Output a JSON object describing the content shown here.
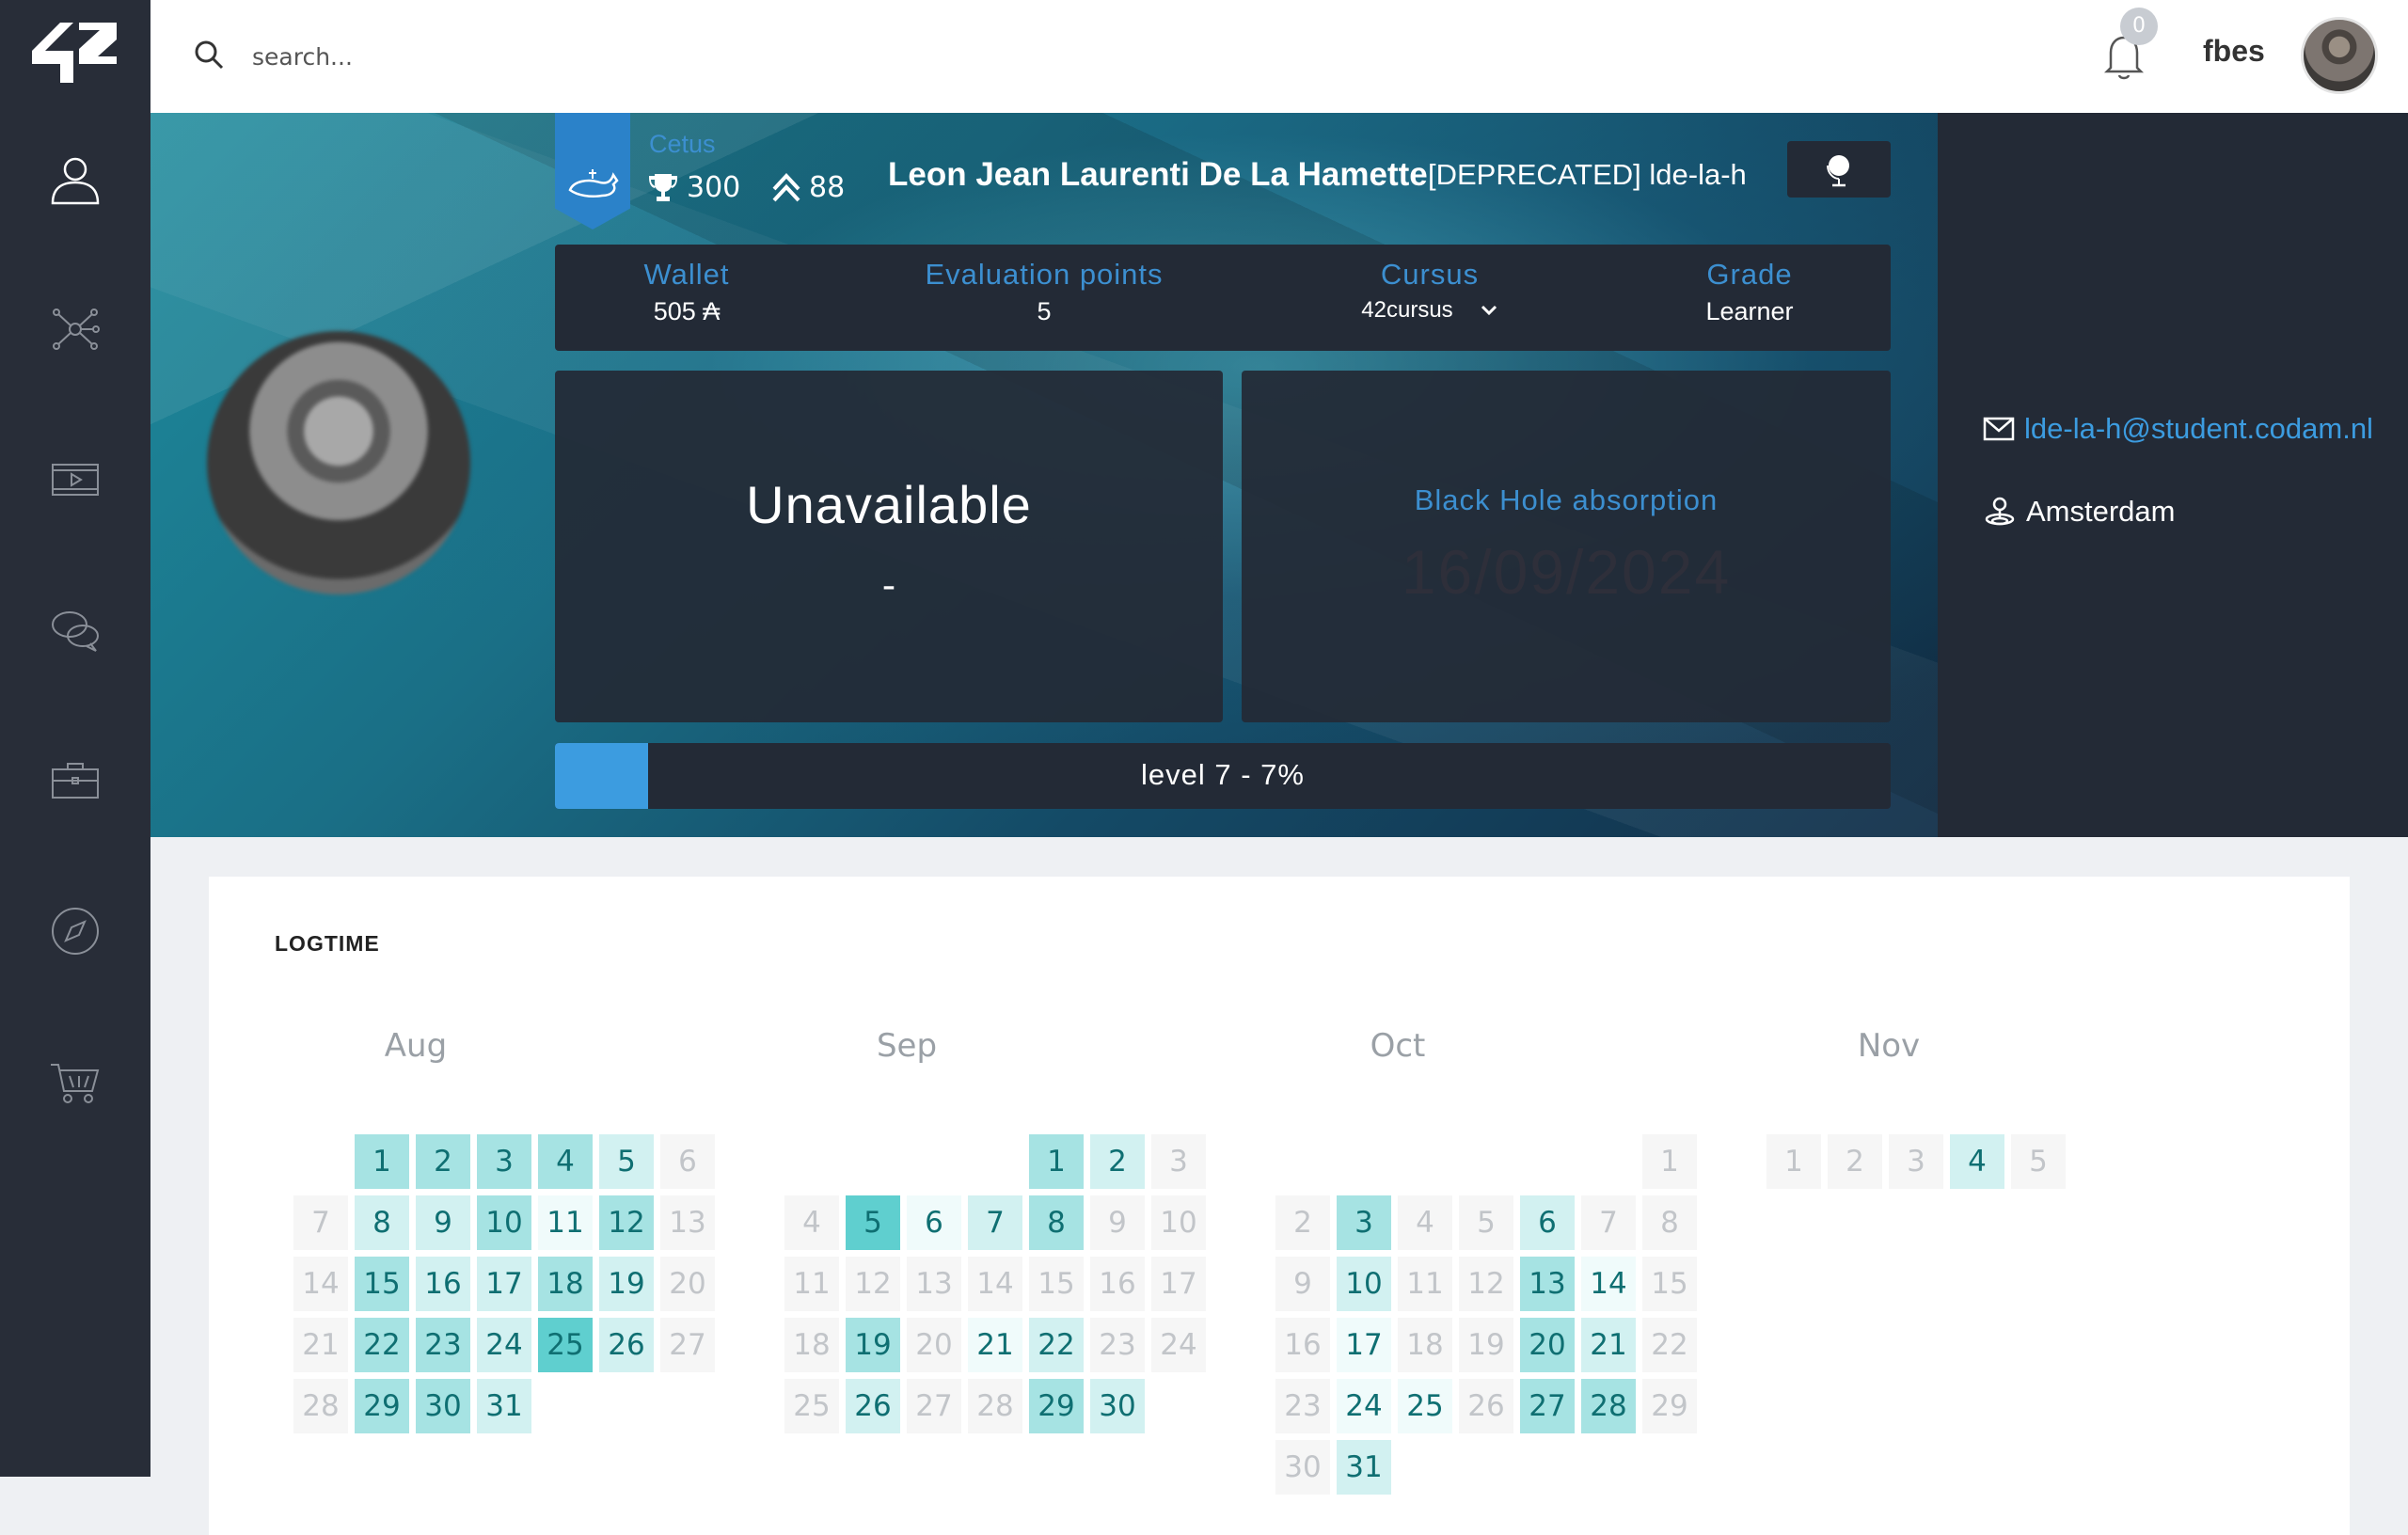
{
  "colors": {
    "sidebar": "#282d38",
    "accent": "#3c8fd0",
    "panel": "#232a36",
    "logtime_dark": "#5fcfcf",
    "logtime_light": "#e6f7f7"
  },
  "sidebar": {
    "icons": [
      "user-icon",
      "network-icon",
      "video-icon",
      "chat-icon",
      "briefcase-icon",
      "compass-icon",
      "cart-icon"
    ]
  },
  "search": {
    "placeholder": "search..."
  },
  "header": {
    "notification_count": "0",
    "username": "fbes"
  },
  "profile": {
    "coalition": "Cetus",
    "trophies": "300",
    "rank": "88",
    "full_name": "Leon Jean Laurenti De La Hamette",
    "login": "[DEPRECATED] lde-la-h",
    "wallet_label": "Wallet",
    "wallet_value": "505 ₳",
    "eval_label": "Evaluation points",
    "eval_value": "5",
    "cursus_label": "Cursus",
    "cursus_value": "42cursus",
    "grade_label": "Grade",
    "grade_value": "Learner",
    "availability": "Unavailable",
    "availability_sub": "-",
    "blackhole_label": "Black Hole absorption",
    "blackhole_date": "16/09/2024",
    "level_text": "level 7 - 7%",
    "level_progress": 0.07,
    "email": "lde-la-h@student.codam.nl",
    "city": "Amsterdam"
  },
  "logtime": {
    "title": "LOGTIME",
    "months": [
      {
        "name": "Aug",
        "rows": [
          [
            null,
            {
              "d": "1",
              "l": 2
            },
            {
              "d": "2",
              "l": 2
            },
            {
              "d": "3",
              "l": 2
            },
            {
              "d": "4",
              "l": 2
            },
            {
              "d": "5",
              "l": 1
            },
            {
              "d": "6",
              "l": 0
            }
          ],
          [
            {
              "d": "7",
              "l": 0
            },
            {
              "d": "8",
              "l": 1
            },
            {
              "d": "9",
              "l": 1
            },
            {
              "d": "10",
              "l": 2
            },
            {
              "d": "11",
              "l": 0.5
            },
            {
              "d": "12",
              "l": 2
            },
            {
              "d": "13",
              "l": 0
            }
          ],
          [
            {
              "d": "14",
              "l": 0
            },
            {
              "d": "15",
              "l": 2
            },
            {
              "d": "16",
              "l": 1
            },
            {
              "d": "17",
              "l": 1
            },
            {
              "d": "18",
              "l": 2
            },
            {
              "d": "19",
              "l": 1
            },
            {
              "d": "20",
              "l": 0
            }
          ],
          [
            {
              "d": "21",
              "l": 0
            },
            {
              "d": "22",
              "l": 2
            },
            {
              "d": "23",
              "l": 2
            },
            {
              "d": "24",
              "l": 1
            },
            {
              "d": "25",
              "l": 3
            },
            {
              "d": "26",
              "l": 1
            },
            {
              "d": "27",
              "l": 0
            }
          ],
          [
            {
              "d": "28",
              "l": 0
            },
            {
              "d": "29",
              "l": 2
            },
            {
              "d": "30",
              "l": 2
            },
            {
              "d": "31",
              "l": 1
            },
            null,
            null,
            null
          ]
        ]
      },
      {
        "name": "Sep",
        "rows": [
          [
            null,
            null,
            null,
            null,
            {
              "d": "1",
              "l": 2
            },
            {
              "d": "2",
              "l": 1
            },
            {
              "d": "3",
              "l": 0
            }
          ],
          [
            {
              "d": "4",
              "l": 0
            },
            {
              "d": "5",
              "l": 3
            },
            {
              "d": "6",
              "l": 0.5
            },
            {
              "d": "7",
              "l": 1
            },
            {
              "d": "8",
              "l": 2
            },
            {
              "d": "9",
              "l": 0
            },
            {
              "d": "10",
              "l": 0
            }
          ],
          [
            {
              "d": "11",
              "l": 0
            },
            {
              "d": "12",
              "l": 0
            },
            {
              "d": "13",
              "l": 0
            },
            {
              "d": "14",
              "l": 0
            },
            {
              "d": "15",
              "l": 0
            },
            {
              "d": "16",
              "l": 0
            },
            {
              "d": "17",
              "l": 0
            }
          ],
          [
            {
              "d": "18",
              "l": 0
            },
            {
              "d": "19",
              "l": 2
            },
            {
              "d": "20",
              "l": 0
            },
            {
              "d": "21",
              "l": 0.5
            },
            {
              "d": "22",
              "l": 1
            },
            {
              "d": "23",
              "l": 0
            },
            {
              "d": "24",
              "l": 0
            }
          ],
          [
            {
              "d": "25",
              "l": 0
            },
            {
              "d": "26",
              "l": 1
            },
            {
              "d": "27",
              "l": 0
            },
            {
              "d": "28",
              "l": 0
            },
            {
              "d": "29",
              "l": 2
            },
            {
              "d": "30",
              "l": 1
            },
            null
          ]
        ]
      },
      {
        "name": "Oct",
        "rows": [
          [
            null,
            null,
            null,
            null,
            null,
            null,
            {
              "d": "1",
              "l": 0
            }
          ],
          [
            {
              "d": "2",
              "l": 0
            },
            {
              "d": "3",
              "l": 2
            },
            {
              "d": "4",
              "l": 0
            },
            {
              "d": "5",
              "l": 0
            },
            {
              "d": "6",
              "l": 1
            },
            {
              "d": "7",
              "l": 0
            },
            {
              "d": "8",
              "l": 0
            }
          ],
          [
            {
              "d": "9",
              "l": 0
            },
            {
              "d": "10",
              "l": 1
            },
            {
              "d": "11",
              "l": 0
            },
            {
              "d": "12",
              "l": 0
            },
            {
              "d": "13",
              "l": 2
            },
            {
              "d": "14",
              "l": 0.5
            },
            {
              "d": "15",
              "l": 0
            }
          ],
          [
            {
              "d": "16",
              "l": 0
            },
            {
              "d": "17",
              "l": 0.5
            },
            {
              "d": "18",
              "l": 0
            },
            {
              "d": "19",
              "l": 0
            },
            {
              "d": "20",
              "l": 2
            },
            {
              "d": "21",
              "l": 1
            },
            {
              "d": "22",
              "l": 0
            }
          ],
          [
            {
              "d": "23",
              "l": 0
            },
            {
              "d": "24",
              "l": 0.5
            },
            {
              "d": "25",
              "l": 0.5
            },
            {
              "d": "26",
              "l": 0
            },
            {
              "d": "27",
              "l": 2
            },
            {
              "d": "28",
              "l": 2
            },
            {
              "d": "29",
              "l": 0
            }
          ],
          [
            {
              "d": "30",
              "l": 0
            },
            {
              "d": "31",
              "l": 1
            },
            null,
            null,
            null,
            null,
            null
          ]
        ]
      },
      {
        "name": "Nov",
        "rows": [
          [
            {
              "d": "1",
              "l": 0
            },
            {
              "d": "2",
              "l": 0
            },
            {
              "d": "3",
              "l": 0
            },
            {
              "d": "4",
              "l": 1
            },
            {
              "d": "5",
              "l": 0
            },
            null,
            null
          ]
        ]
      }
    ]
  }
}
